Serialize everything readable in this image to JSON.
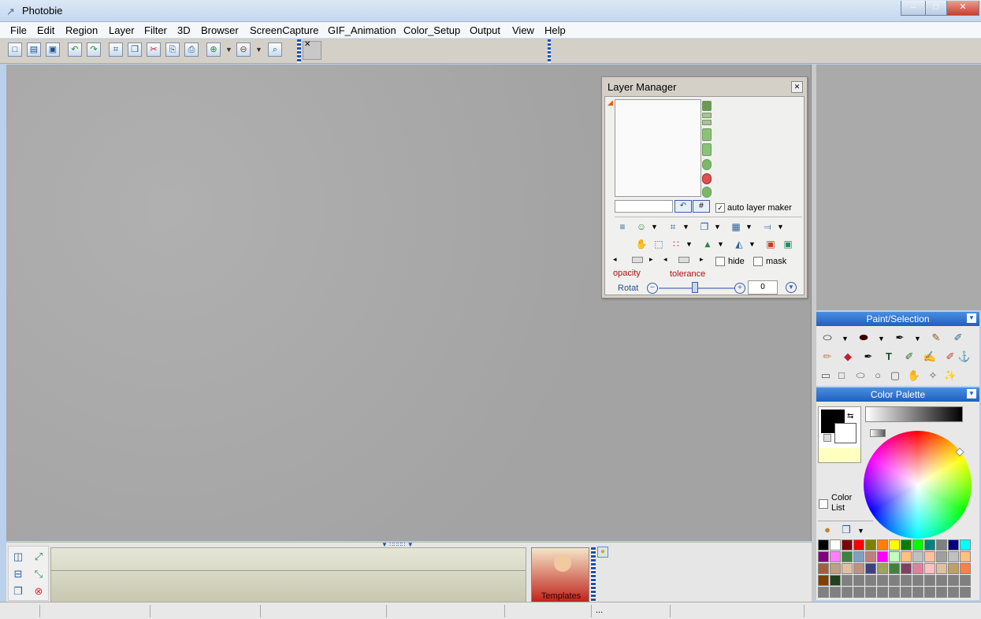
{
  "window": {
    "title": "Photobie",
    "min": "–",
    "max": "□",
    "close": "✕"
  },
  "menu": [
    "File",
    "Edit",
    "Region",
    "Layer",
    "Filter",
    "3D",
    "Browser",
    "ScreenCapture",
    "GIF_Animation",
    "Color_Setup",
    "Output",
    "View",
    "Help"
  ],
  "layer_manager": {
    "title": "Layer Manager",
    "auto_layer": "auto layer maker",
    "hide": "hide",
    "mask": "mask",
    "opacity": "opacity",
    "tolerance": "tolerance",
    "rotate": "Rotat",
    "rotate_value": "0",
    "hash_btn": "#"
  },
  "paint_selection": {
    "title": "Paint/Selection",
    "text_tool": "T"
  },
  "color_palette": {
    "title": "Color Palette",
    "color_list": "Color List"
  },
  "thumbnail": {
    "label": "Templates"
  },
  "colors": {
    "accent": "#1f5fc2",
    "swatches_row1": [
      "#000000",
      "#ffffff",
      "#800000",
      "#ff0000",
      "#808000",
      "#ff8000",
      "#ffff00",
      "#008000",
      "#00ff00",
      "#008080",
      "#808080",
      "#000080",
      "#00ffff"
    ],
    "swatches_row2": [
      "#800080",
      "#ff80ff",
      "#408040",
      "#80a0c0",
      "#c08080",
      "#ff00ff",
      "#c0ffc0",
      "#ffc080",
      "#c0c0c0",
      "#ffc0a0",
      "#a0a0a0",
      "#c0c0c0",
      "#ffc080"
    ],
    "swatches_row3": [
      "#a06040",
      "#c0a080",
      "#e0c0a0",
      "#c09080",
      "#404080",
      "#a0a060",
      "#408040",
      "#804060",
      "#e080a0",
      "#ffc0c0",
      "#e0c0a0",
      "#c0a060",
      "#ff8040"
    ],
    "swatches_row4": [
      "#804000",
      "#204020",
      "#808080",
      "#808080",
      "#808080",
      "#808080",
      "#808080",
      "#808080",
      "#808080",
      "#808080",
      "#808080",
      "#808080",
      "#808080"
    ],
    "swatches_row5": [
      "#808080",
      "#808080",
      "#808080",
      "#808080",
      "#808080",
      "#808080",
      "#808080",
      "#808080",
      "#808080",
      "#808080",
      "#808080",
      "#808080",
      "#808080"
    ]
  }
}
